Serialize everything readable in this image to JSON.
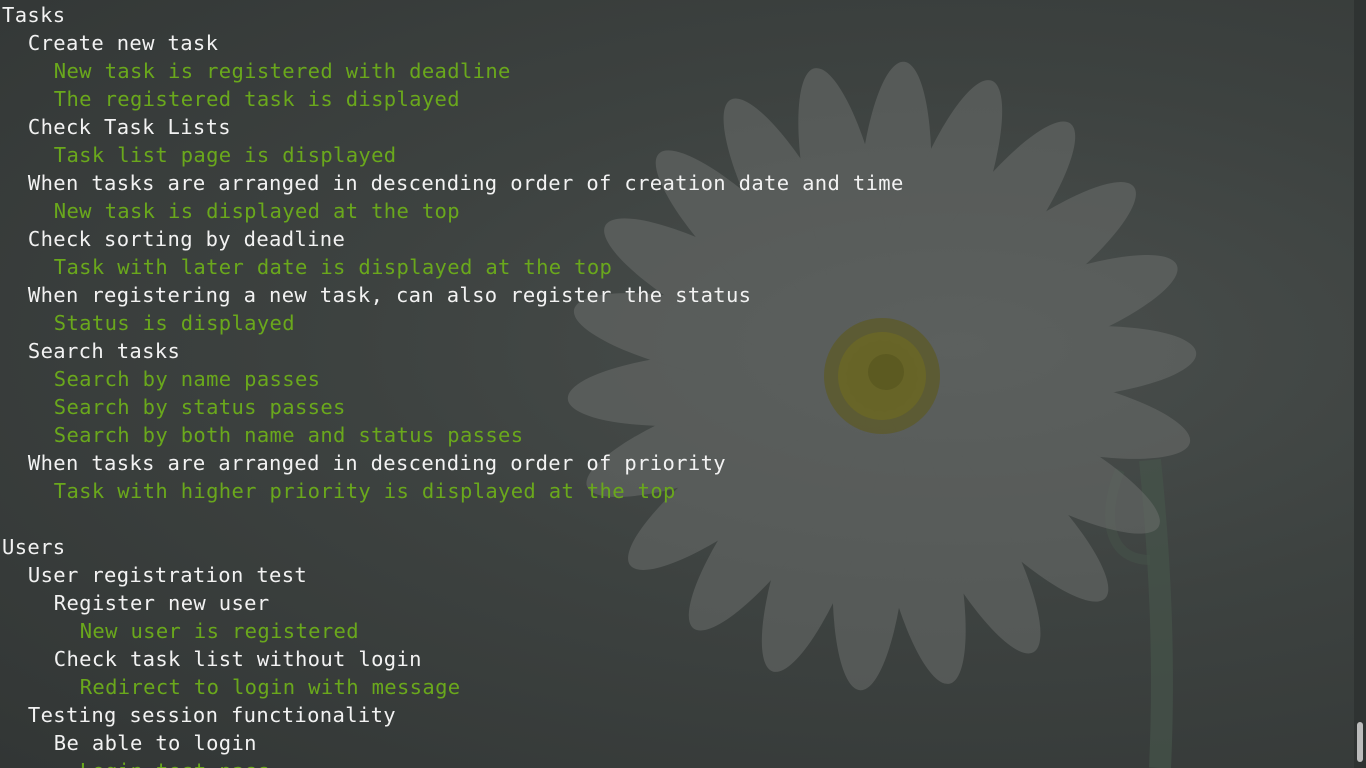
{
  "terminal": {
    "lines": [
      {
        "text": "Tasks",
        "indent": 0,
        "color": "white"
      },
      {
        "text": "Create new task",
        "indent": 1,
        "color": "white"
      },
      {
        "text": "New task is registered with deadline",
        "indent": 2,
        "color": "green"
      },
      {
        "text": "The registered task is displayed",
        "indent": 2,
        "color": "green"
      },
      {
        "text": "Check Task Lists",
        "indent": 1,
        "color": "white"
      },
      {
        "text": "Task list page is displayed",
        "indent": 2,
        "color": "green"
      },
      {
        "text": "When tasks are arranged in descending order of creation date and time",
        "indent": 1,
        "color": "white"
      },
      {
        "text": "New task is displayed at the top",
        "indent": 2,
        "color": "green"
      },
      {
        "text": "Check sorting by deadline",
        "indent": 1,
        "color": "white"
      },
      {
        "text": "Task with later date is displayed at the top",
        "indent": 2,
        "color": "green"
      },
      {
        "text": "When registering a new task, can also register the status",
        "indent": 1,
        "color": "white"
      },
      {
        "text": "Status is displayed",
        "indent": 2,
        "color": "green"
      },
      {
        "text": "Search tasks",
        "indent": 1,
        "color": "white"
      },
      {
        "text": "Search by name passes",
        "indent": 2,
        "color": "green"
      },
      {
        "text": "Search by status passes",
        "indent": 2,
        "color": "green"
      },
      {
        "text": "Search by both name and status passes",
        "indent": 2,
        "color": "green"
      },
      {
        "text": "When tasks are arranged in descending order of priority",
        "indent": 1,
        "color": "white"
      },
      {
        "text": "Task with higher priority is displayed at the top",
        "indent": 2,
        "color": "green"
      },
      {
        "text": "",
        "indent": 0,
        "color": "white"
      },
      {
        "text": "Users",
        "indent": 0,
        "color": "white"
      },
      {
        "text": "User registration test",
        "indent": 1,
        "color": "white"
      },
      {
        "text": "Register new user",
        "indent": 2,
        "color": "white"
      },
      {
        "text": "New user is registered",
        "indent": 3,
        "color": "green"
      },
      {
        "text": "Check task list without login",
        "indent": 2,
        "color": "white"
      },
      {
        "text": "Redirect to login with message",
        "indent": 3,
        "color": "green"
      },
      {
        "text": "Testing session functionality",
        "indent": 1,
        "color": "white"
      },
      {
        "text": "Be able to login",
        "indent": 2,
        "color": "white"
      },
      {
        "text": "Login test pass",
        "indent": 3,
        "color": "green"
      }
    ]
  },
  "colors": {
    "white": "#f2f2f2",
    "green": "#6aa81c",
    "background": "#3d4240"
  },
  "scrollbar": {
    "position_fraction": 1.0
  }
}
